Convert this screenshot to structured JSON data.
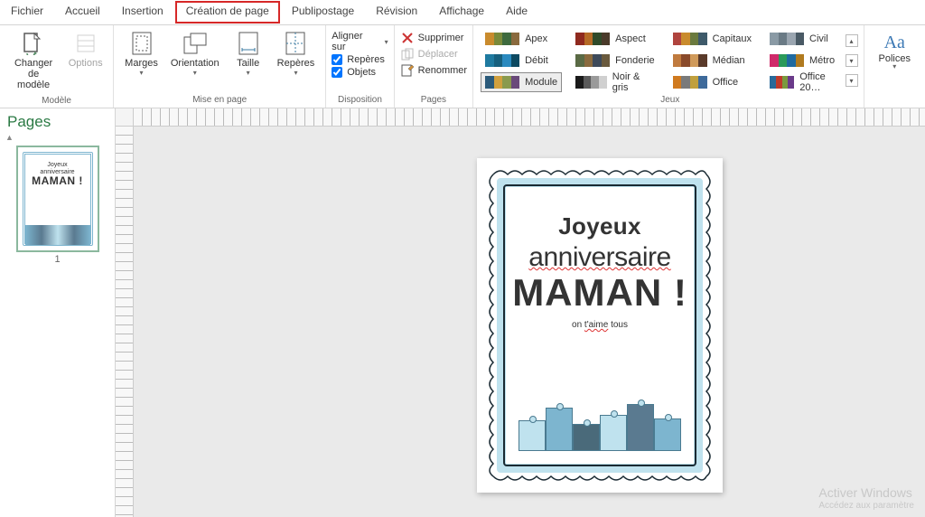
{
  "menu": {
    "items": [
      "Fichier",
      "Accueil",
      "Insertion",
      "Création de page",
      "Publipostage",
      "Révision",
      "Affichage",
      "Aide"
    ],
    "active_index": 3
  },
  "ribbon": {
    "groups": {
      "model": {
        "label": "Modèle",
        "change": "Changer\nde modèle",
        "options": "Options"
      },
      "layout": {
        "label": "Mise en page",
        "margins": "Marges",
        "orientation": "Orientation",
        "size": "Taille",
        "guides": "Repères"
      },
      "disposition": {
        "label": "Disposition",
        "align": "Aligner sur",
        "guides_chk": "Repères",
        "objects_chk": "Objets"
      },
      "pages": {
        "label": "Pages",
        "delete": "Supprimer",
        "move": "Déplacer",
        "rename": "Renommer"
      },
      "themes": {
        "label": "Jeux",
        "items": [
          {
            "name": "Apex",
            "colors": [
              "#c98b2d",
              "#7a8a3a",
              "#3e6a3e",
              "#8a6a3e"
            ]
          },
          {
            "name": "Aspect",
            "colors": [
              "#8f2a1f",
              "#b56a26",
              "#2f4a2a",
              "#4a3a2a"
            ]
          },
          {
            "name": "Capitaux",
            "colors": [
              "#b0443e",
              "#c98b2d",
              "#6a7a3e",
              "#3e5a6a"
            ]
          },
          {
            "name": "Civil",
            "colors": [
              "#8a9aa5",
              "#6a7a85",
              "#9aa5b0",
              "#4a5a65"
            ]
          },
          {
            "name": "Débit",
            "colors": [
              "#1f7aa0",
              "#17607e",
              "#2a8abf",
              "#0d4a62"
            ]
          },
          {
            "name": "Fonderie",
            "colors": [
              "#5a6a45",
              "#8a6a3e",
              "#3e4a5a",
              "#6a5a3e"
            ]
          },
          {
            "name": "Médian",
            "colors": [
              "#c07a3e",
              "#8a4a2a",
              "#d09a5a",
              "#5a3a2a"
            ]
          },
          {
            "name": "Métro",
            "colors": [
              "#cf2a6a",
              "#2a9a5a",
              "#1f6aa0",
              "#b07a1f"
            ]
          },
          {
            "name": "Module",
            "colors": [
              "#2a5a7a",
              "#d0a03e",
              "#8a9a4e",
              "#6a4a7a"
            ],
            "selected": true
          },
          {
            "name": "Noir & gris",
            "colors": [
              "#1a1a1a",
              "#5a5a5a",
              "#9a9a9a",
              "#d0d0d0"
            ]
          },
          {
            "name": "Office",
            "colors": [
              "#d07a1f",
              "#7a7a7a",
              "#c0a03e",
              "#3e6a9a"
            ]
          },
          {
            "name": "Office 20…",
            "colors": [
              "#2a6a9a",
              "#c03a2a",
              "#7a9a3e",
              "#6a3a8a"
            ]
          }
        ]
      },
      "fonts": {
        "label": "Polices",
        "button": "Polices",
        "icon_text": "Aa"
      }
    }
  },
  "pages_panel": {
    "title": "Pages",
    "page_number": "1"
  },
  "document": {
    "line1": "Joyeux",
    "line2_a": "anniversaire",
    "line3": "MAMAN !",
    "line4_a": "on ",
    "line4_b": "t'aime",
    "line4_c": " tous"
  },
  "watermark": {
    "title": "Activer Windows",
    "sub": "Accédez aux paramètre"
  }
}
